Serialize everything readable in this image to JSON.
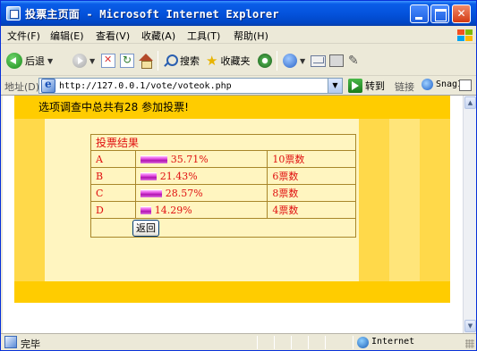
{
  "window": {
    "title": "投票主页面 - Microsoft Internet Explorer",
    "min_label": "",
    "max_label": "",
    "close_label": "✕"
  },
  "menu": [
    "文件(F)",
    "编辑(E)",
    "查看(V)",
    "收藏(A)",
    "工具(T)",
    "帮助(H)"
  ],
  "toolbar": {
    "back_label": "后退",
    "search_label": "搜索",
    "favorites_label": "收藏夹",
    "icons": [
      "back-icon",
      "forward-icon",
      "stop-icon",
      "refresh-icon",
      "home-icon",
      "search-icon",
      "favorites-icon",
      "media-icon",
      "history-icon",
      "mail-icon",
      "print-icon",
      "edit-icon"
    ]
  },
  "address": {
    "label": "地址(D)",
    "url": "http://127.0.0.1/vote/voteok.php",
    "go_label": "转到",
    "links_label": "链接",
    "snagit_label": "SnagIt"
  },
  "page": {
    "caption": "选项调查中总共有28 参加投票!",
    "result_header": "投票结果",
    "rows": [
      {
        "option": "A",
        "percent": "35.71%",
        "votes": "10票数",
        "fraction": 0.3571
      },
      {
        "option": "B",
        "percent": "21.43%",
        "votes": "6票数",
        "fraction": 0.2143
      },
      {
        "option": "C",
        "percent": "28.57%",
        "votes": "8票数",
        "fraction": 0.2857
      },
      {
        "option": "D",
        "percent": "14.29%",
        "votes": "4票数",
        "fraction": 0.1429
      }
    ],
    "return_label": "返回"
  },
  "status": {
    "text": "完毕",
    "zone": "Internet"
  },
  "colors": {
    "outer_band": "#ffcc00",
    "panel": "#fff5c0",
    "table_text": "#e01010",
    "table_border": "#a8862a",
    "bar": "#d040d0"
  }
}
